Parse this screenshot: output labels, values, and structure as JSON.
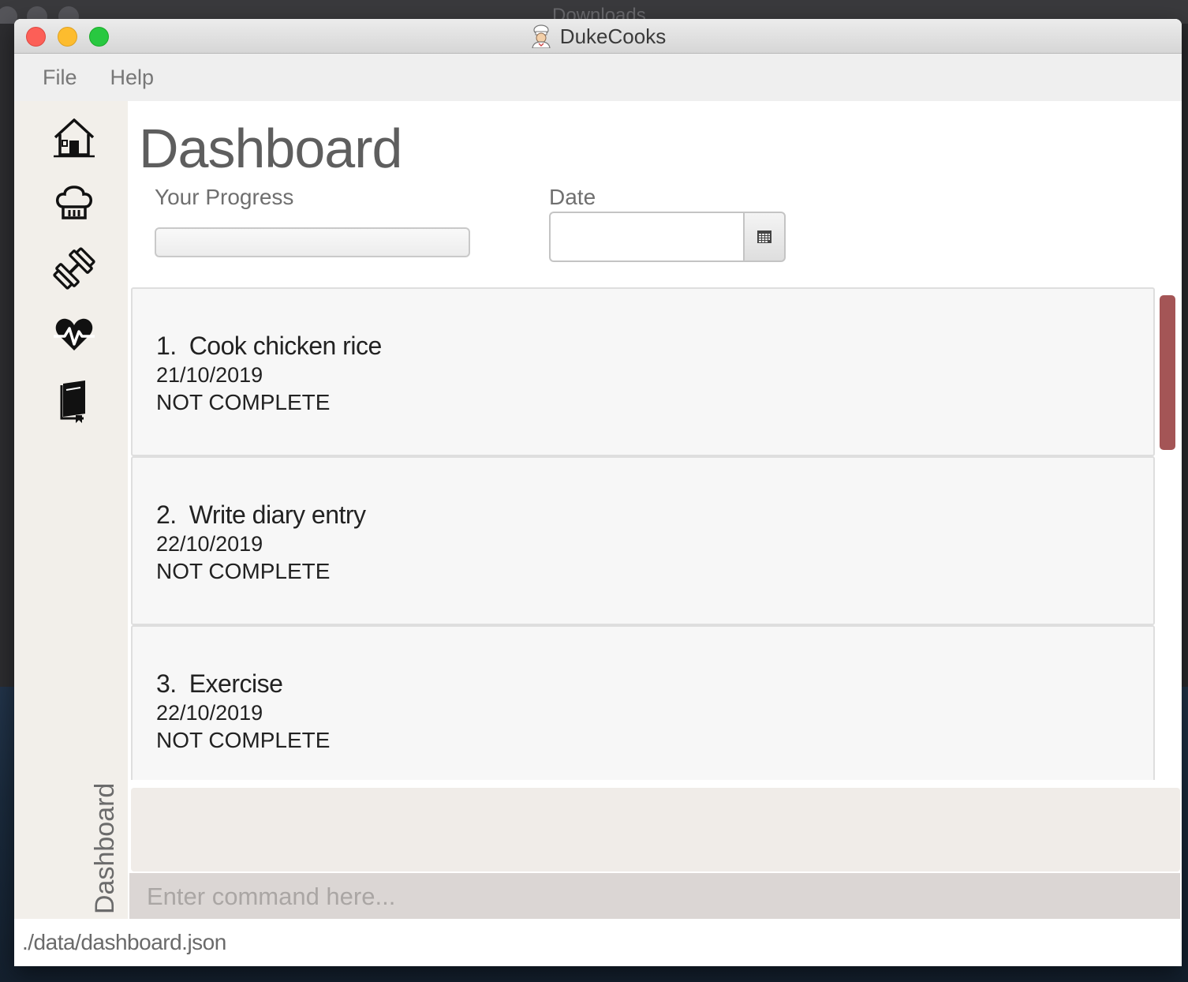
{
  "window": {
    "title": "DukeCooks",
    "background_title": "Downloads"
  },
  "menu": {
    "items": [
      {
        "label": "File"
      },
      {
        "label": "Help"
      }
    ]
  },
  "sidebar": {
    "items": [
      {
        "icon": "house-icon",
        "target": "dashboard"
      },
      {
        "icon": "chef-hat-icon",
        "target": "recipes"
      },
      {
        "icon": "dumbbell-icon",
        "target": "exercise"
      },
      {
        "icon": "heart-pulse-icon",
        "target": "health"
      },
      {
        "icon": "diary-book-icon",
        "target": "diary"
      }
    ],
    "current_view_label": "Dashboard"
  },
  "dashboard": {
    "title": "Dashboard",
    "progress_label": "Your Progress",
    "progress_value": 0,
    "date_label": "Date",
    "date_value": "",
    "tasks": [
      {
        "number": "1.",
        "name": "Cook chicken rice",
        "date": "21/10/2019",
        "status": "NOT COMPLETE"
      },
      {
        "number": "2.",
        "name": "Write diary entry",
        "date": "22/10/2019",
        "status": "NOT COMPLETE"
      },
      {
        "number": "3.",
        "name": "Exercise",
        "date": "22/10/2019",
        "status": "NOT COMPLETE"
      }
    ]
  },
  "result_display": {
    "text": ""
  },
  "command": {
    "placeholder": "Enter command here...",
    "value": ""
  },
  "status_bar": {
    "file_path": "./data/dashboard.json"
  },
  "colors": {
    "scrollbar_thumb": "#a45556",
    "sidebar_bg": "#f2efea",
    "command_bg": "#dbd6d4",
    "card_bg": "#f7f7f7"
  }
}
